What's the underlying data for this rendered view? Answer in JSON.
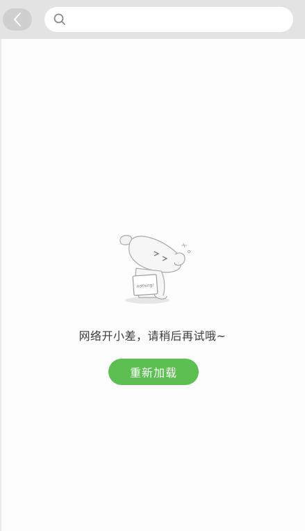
{
  "header": {
    "back_icon": "chevron-left-icon",
    "search": {
      "icon": "search-icon",
      "value": "",
      "placeholder": ""
    }
  },
  "empty_state": {
    "illustration": "dog-holding-nothing-sign",
    "sign_text": "nothing!",
    "message": "网络开小差，请稍后再试哦~",
    "reload_label": "重新加载"
  },
  "colors": {
    "topbar_bg": "#e3e3e3",
    "back_button_bg": "#cfcfcf",
    "reload_button_bg": "#5dbf52",
    "message_text": "#3a3a3a"
  }
}
